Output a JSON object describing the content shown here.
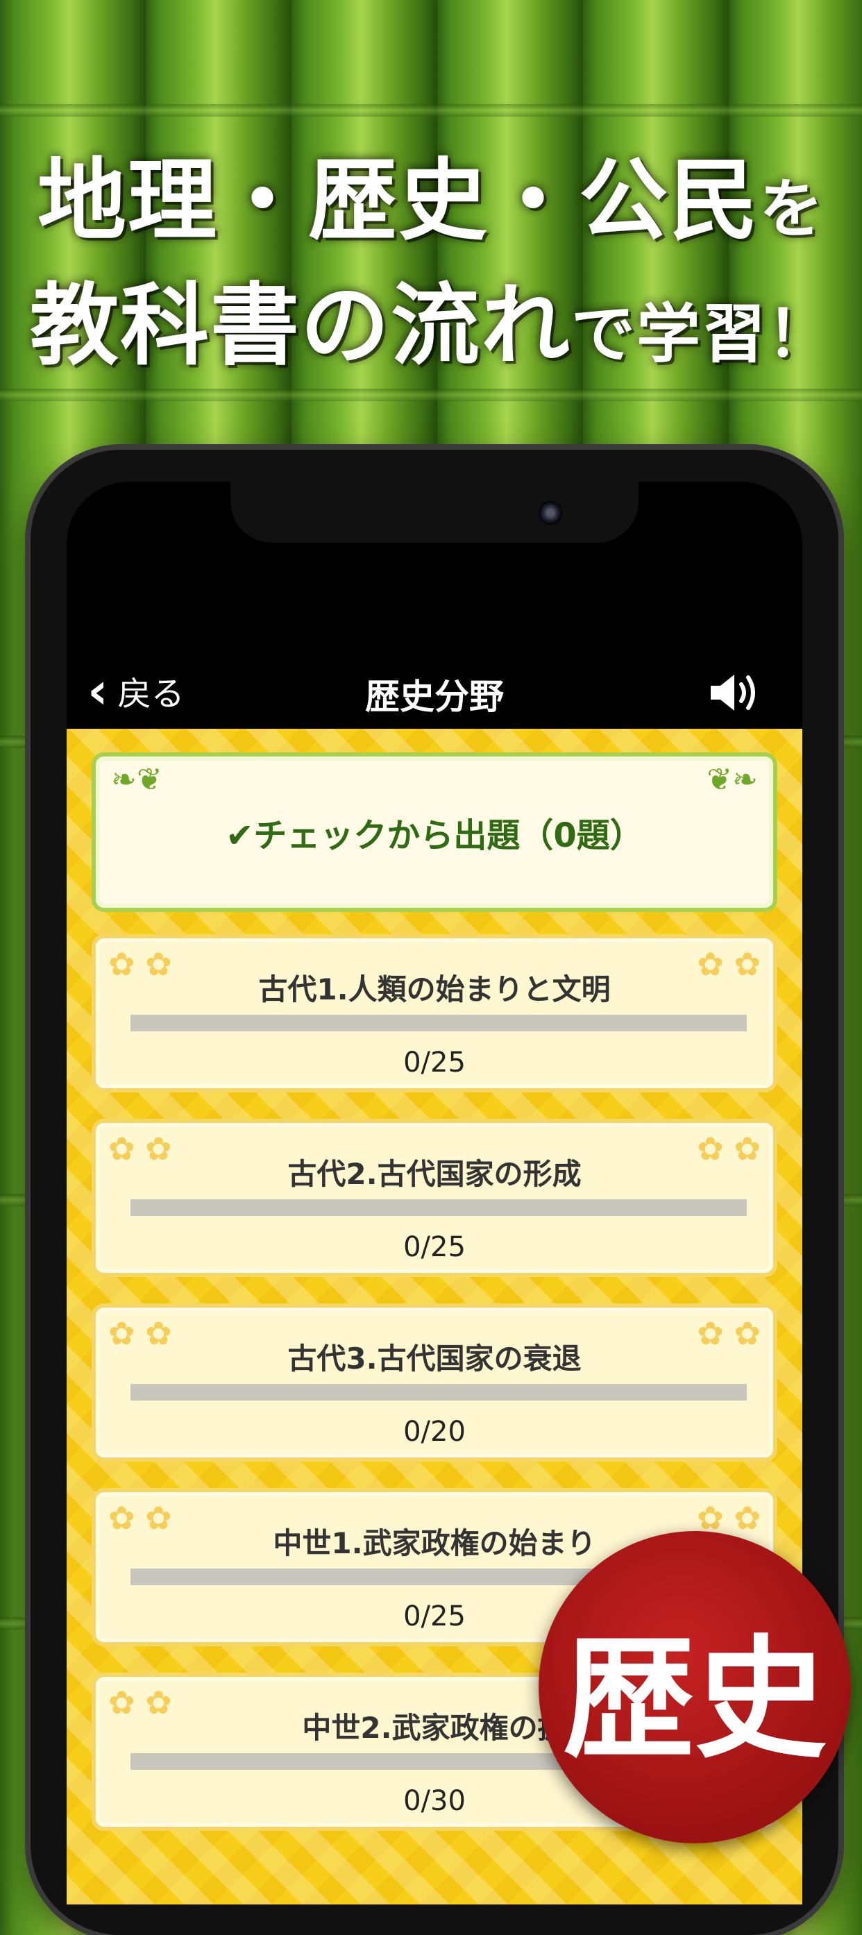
{
  "headline": {
    "line1_a": "地理・歴史・公民",
    "line1_b": "を",
    "line2_a": "教科書の流れ",
    "line2_b": "で学習！"
  },
  "nav": {
    "back_label": "戻る",
    "title": "歴史分野"
  },
  "check_item": {
    "label": "✔チェックから出題（0題）"
  },
  "chapters": [
    {
      "title": "古代1.人類の始まりと文明",
      "progress": "0/25"
    },
    {
      "title": "古代2.古代国家の形成",
      "progress": "0/25"
    },
    {
      "title": "古代3.古代国家の衰退",
      "progress": "0/20"
    },
    {
      "title": "中世1.武家政権の始まり",
      "progress": "0/25"
    },
    {
      "title": "中世2.武家政権の拡",
      "progress": "0/30"
    }
  ],
  "badge": {
    "text": "歴史"
  },
  "colors": {
    "accent_green": "#6ea82a",
    "badge_red": "#b31a1a",
    "list_background": "#f7cf1a"
  }
}
